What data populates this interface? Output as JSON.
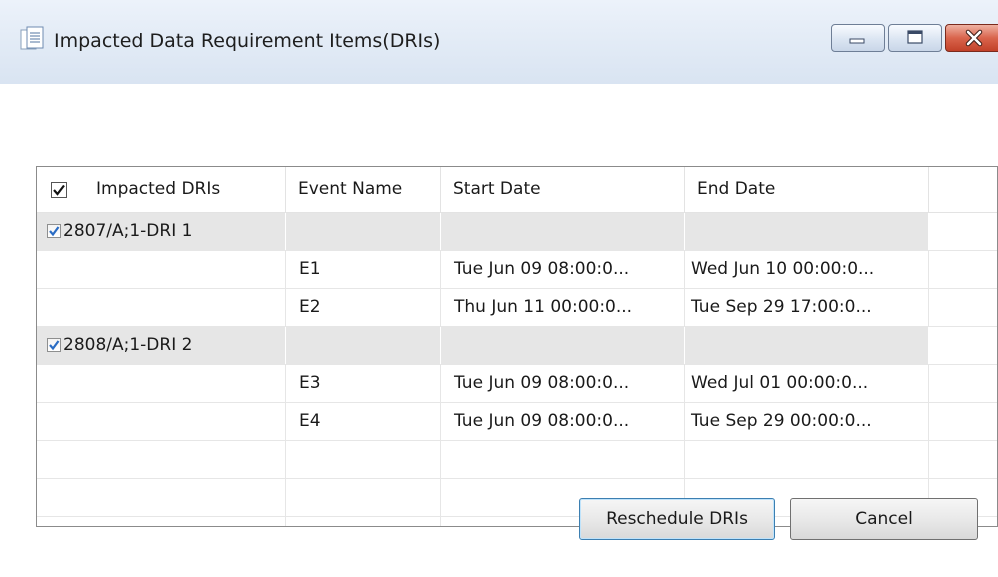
{
  "window": {
    "title": "Impacted Data Requirement Items(DRIs)"
  },
  "icons": {
    "title": "document-list-icon",
    "minimize": "minimize-icon",
    "maximize": "maximize-icon",
    "close": "close-icon",
    "checkbox": "checkmark-icon"
  },
  "table": {
    "header_checked": true,
    "columns": [
      "Impacted DRIs",
      "Event Name",
      "Start Date",
      "End Date"
    ],
    "groups": [
      {
        "dri": "2807/A;1-DRI 1",
        "checked": true,
        "events": [
          {
            "name": "E1",
            "start": "Tue Jun 09 08:00:0...",
            "end": "Wed Jun 10 00:00:0..."
          },
          {
            "name": "E2",
            "start": "Thu Jun 11 00:00:0...",
            "end": "Tue Sep 29 17:00:0..."
          }
        ]
      },
      {
        "dri": "2808/A;1-DRI 2",
        "checked": true,
        "events": [
          {
            "name": "E3",
            "start": "Tue Jun 09 08:00:0...",
            "end": "Wed Jul 01 00:00:0..."
          },
          {
            "name": "E4",
            "start": "Tue Jun 09 08:00:0...",
            "end": "Tue Sep 29 00:00:0..."
          }
        ]
      }
    ]
  },
  "buttons": {
    "reschedule": "Reschedule DRIs",
    "cancel": "Cancel"
  },
  "colors": {
    "group_row_bg": "#e6e6e6",
    "checkbox_check": "#2a6cc4",
    "close_button": "#c24129",
    "default_button_border": "#3c7fb1"
  }
}
